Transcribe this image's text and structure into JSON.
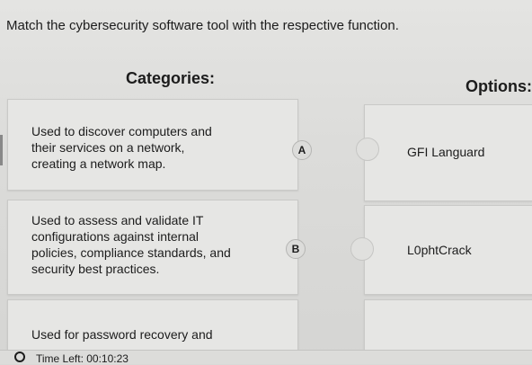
{
  "question": "Match the cybersecurity software tool with the respective function.",
  "categories_heading": "Categories:",
  "options_heading": "Options:",
  "categories": [
    {
      "text_lines": [
        "Used to discover computers and",
        "their services on a network,",
        "creating a network map."
      ],
      "letter": "A"
    },
    {
      "text_lines": [
        "Used to assess and validate IT",
        "configurations against internal",
        "policies, compliance standards, and",
        "security best practices."
      ],
      "letter": "B"
    },
    {
      "text_lines": [
        "Used for password recovery and"
      ]
    }
  ],
  "options": [
    "GFI Languard",
    "L0phtCrack"
  ],
  "timer": {
    "label": "Time Left:",
    "value": "00:10:23"
  },
  "colors": {
    "background": "#d9d9d7",
    "card": "#e6e6e4",
    "text": "#1c1c1c"
  }
}
